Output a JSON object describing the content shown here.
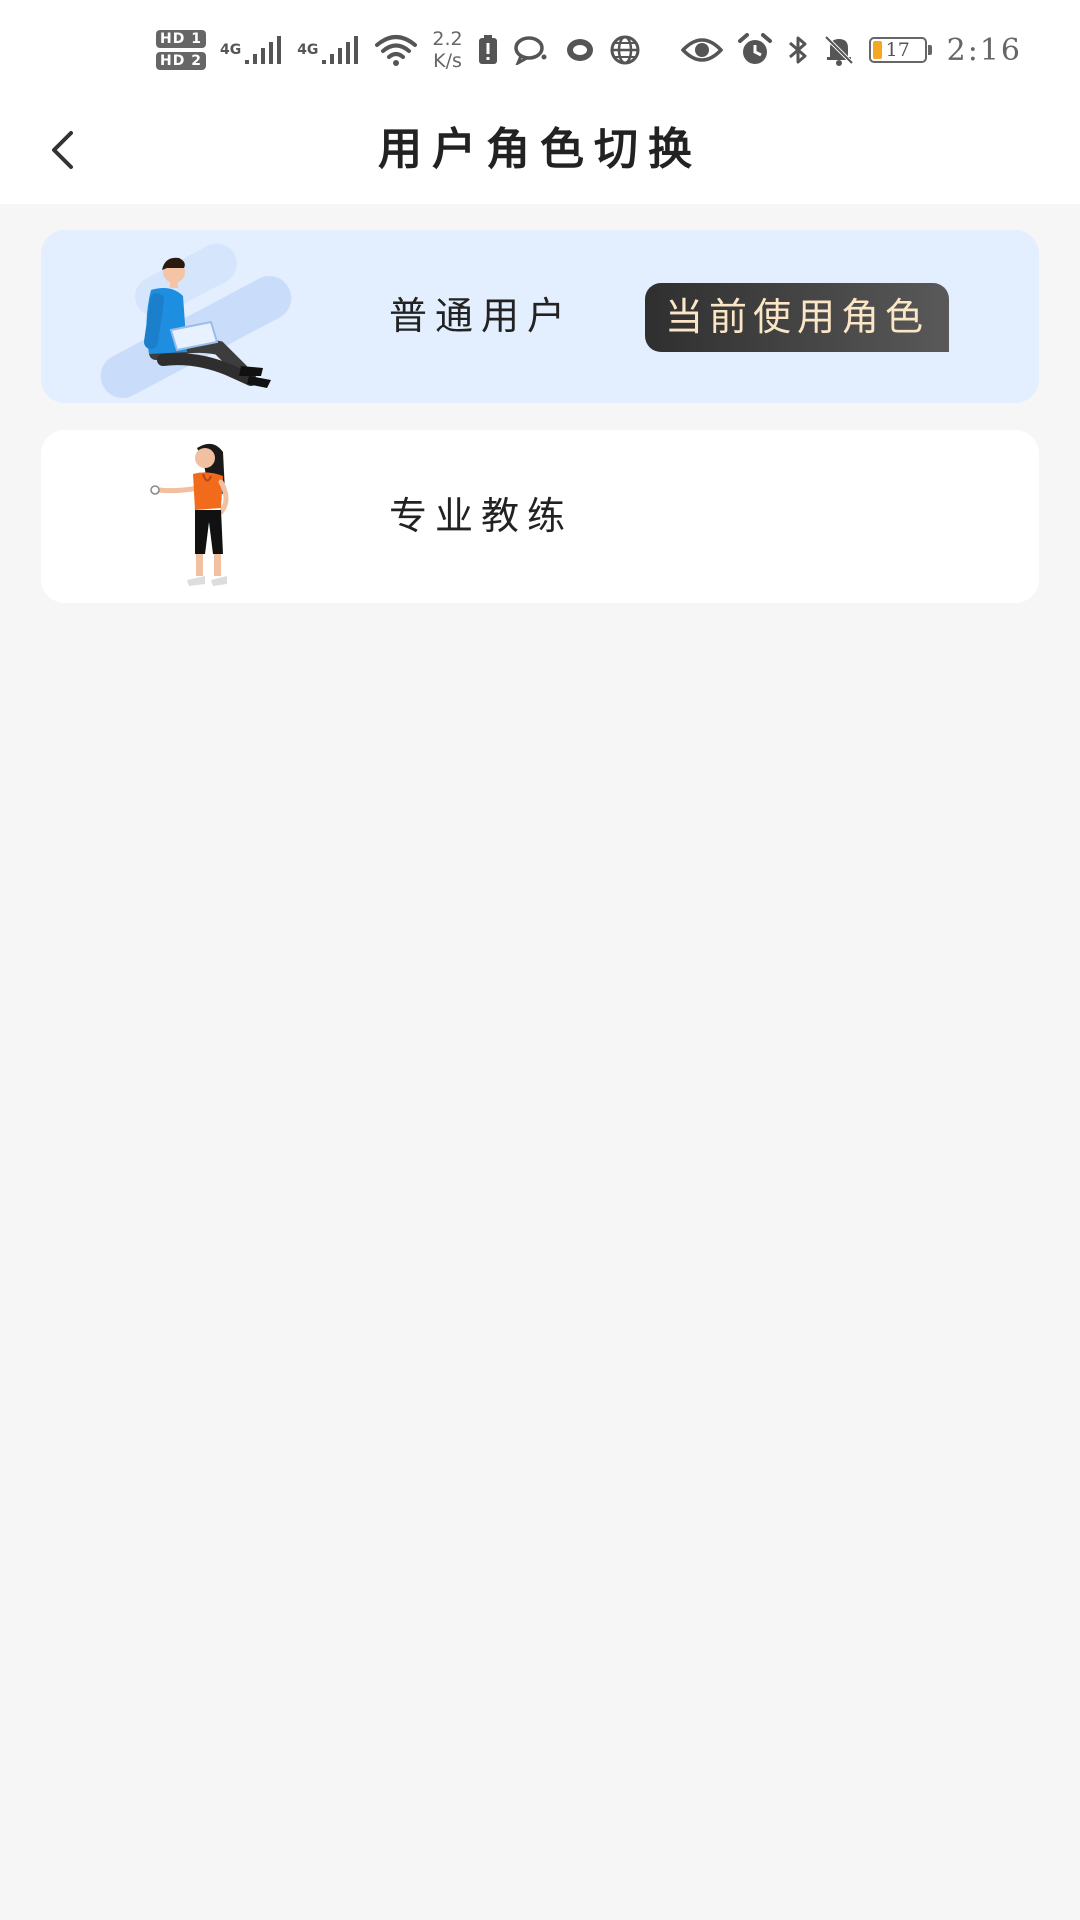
{
  "status_bar": {
    "hd1": "HD 1",
    "hd2": "HD 2",
    "signal1_label": "4G",
    "signal2_label": "4G",
    "net_speed_value": "2.2",
    "net_speed_unit": "K/s",
    "battery_level": "17",
    "time": "2:16"
  },
  "header": {
    "back_icon": "chevron-left-icon",
    "title": "用户角色切换"
  },
  "roles": [
    {
      "label": "普通用户",
      "illustration": "person-with-laptop",
      "is_current": true,
      "badge": "当前使用角色"
    },
    {
      "label": "专业教练",
      "illustration": "coach-woman-with-stopwatch",
      "is_current": false
    }
  ],
  "colors": {
    "page_background": "#f6f6f6",
    "current_card_background": "#e3eefe",
    "card_background": "#ffffff",
    "badge_background": "#3a3a3b",
    "badge_text": "#fbe6c6",
    "battery_fill": "#f5a623"
  }
}
